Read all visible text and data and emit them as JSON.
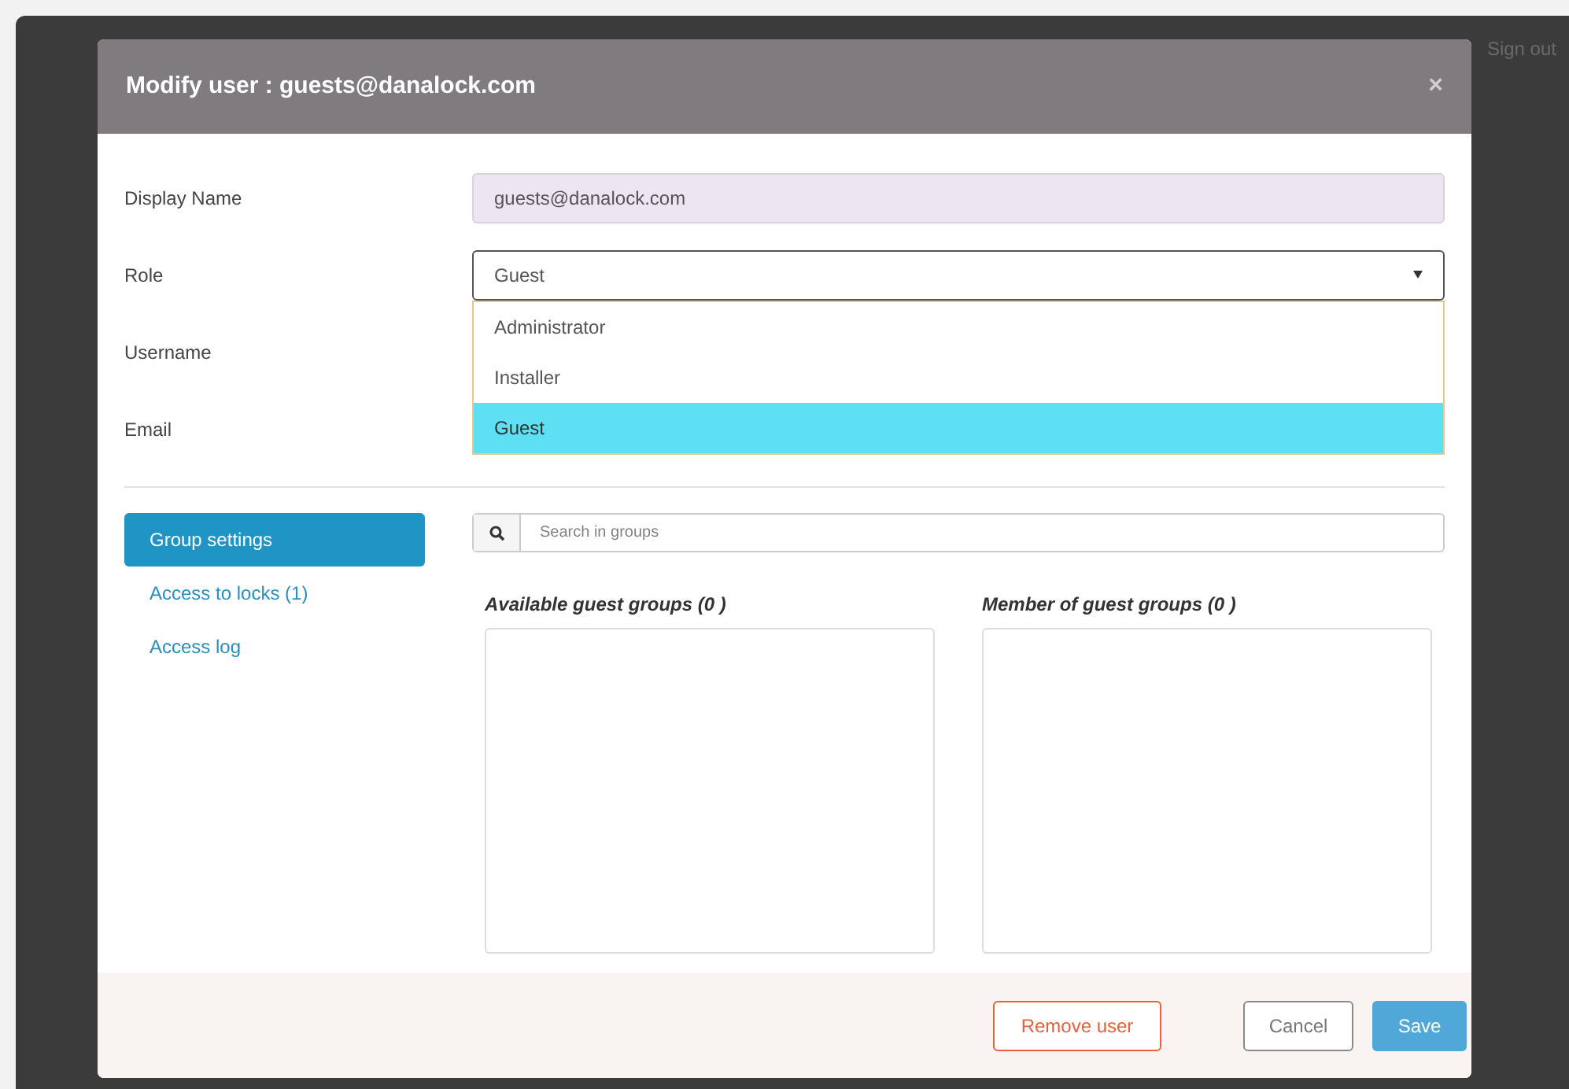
{
  "background_app": {
    "sign_out": "Sign out"
  },
  "dialog": {
    "title": "Modify user : guests@danalock.com",
    "close": "×",
    "fields": [
      {
        "label": "Display Name",
        "kind": "readonly",
        "value": "guests@danalock.com"
      },
      {
        "label": "Role",
        "kind": "select",
        "value": "Guest",
        "expanded": true,
        "options": [
          {
            "label": "Administrator",
            "selected": false
          },
          {
            "label": "Installer",
            "selected": false
          },
          {
            "label": "Guest",
            "selected": true
          }
        ]
      },
      {
        "label": "Username",
        "kind": "covered"
      },
      {
        "label": "Email",
        "kind": "covered"
      }
    ],
    "nav": [
      {
        "label": "Group settings",
        "selected": true
      },
      {
        "label": "Access to locks (1)",
        "selected": false
      },
      {
        "label": "Access log",
        "selected": false
      }
    ],
    "search": {
      "placeholder": "Search in groups"
    },
    "lists": [
      {
        "title": "Available guest groups (0 )"
      },
      {
        "title": "Member of guest groups (0 )"
      }
    ],
    "buttons": [
      {
        "label": "Remove user",
        "kind": "danger"
      },
      {
        "label": "Cancel",
        "kind": "default"
      },
      {
        "label": "Save",
        "kind": "primary"
      }
    ]
  }
}
